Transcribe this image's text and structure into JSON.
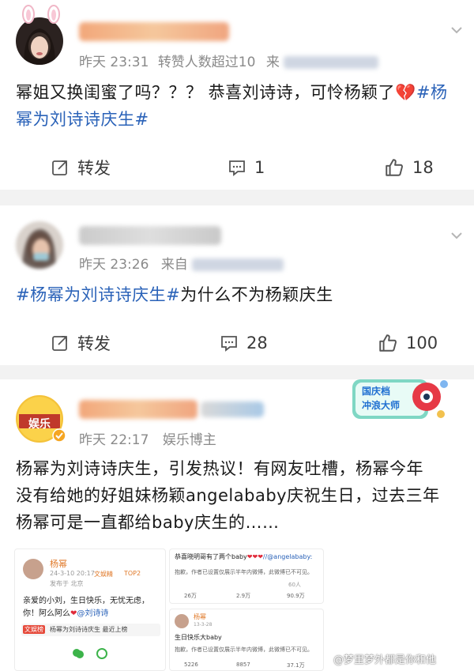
{
  "posts": [
    {
      "time": "昨天 23:31",
      "reposts_note": "转赞人数超过10",
      "source_prefix": "来",
      "content_text": "幂姐又换闺蜜了吗？？？  恭喜刘诗诗，可怜杨颖了",
      "hashtag": "#杨幂为刘诗诗庆生#",
      "repost_label": "转发",
      "comments": "1",
      "likes": "18"
    },
    {
      "time": "昨天 23:26",
      "source_prefix": "来自",
      "hashtag": "#杨幂为刘诗诗庆生#",
      "content_text": "为什么不为杨颖庆生",
      "repost_label": "转发",
      "comments": "28",
      "likes": "100"
    },
    {
      "time": "昨天 22:17",
      "source": "娱乐博主",
      "avatar_text": "娱乐",
      "badge_text_1": "国庆档",
      "badge_text_2": "冲浪大师",
      "content_lines": [
        "杨幂为刘诗诗庆生，引发热议！有网友吐槽，杨幂今年",
        "没有给她的好姐妹杨颖angelababy庆祝生日，过去三年",
        "杨幂可是一直都给baby庆生的……"
      ]
    }
  ],
  "screenshot": {
    "left": {
      "name": "杨幂",
      "date": "24-3-10 20:17",
      "tag1": "文娱精",
      "tag2": "TOP2",
      "loc": "发布于 北京",
      "text1": "亲爱的小刘，生日快乐，无忧无虑，",
      "text2": "你！阿么阿么",
      "mention": "@刘诗诗",
      "chip_tag": "文娱榜",
      "chip_text": "杨幂为刘诗诗庆生 最近上榜"
    },
    "right_top": {
      "text": "恭喜晓明哥有了两个baby",
      "mention": "//@angelababy:",
      "notice": "抱歉，作者已设置仅展示半年内微博，此微博已不可见。",
      "stat1": "26万",
      "stat2": "2.9万",
      "stat3": "90.9万",
      "small": "60人"
    },
    "right_bottom": {
      "name": "杨幂",
      "date": "13-3-28",
      "text": "生日快乐大baby",
      "notice": "抱歉，作者已设置仅展示半年内微博，此微博已不可见。",
      "stat1": "5226",
      "stat2": "8857",
      "stat3": "37.1万"
    },
    "watermark": "@梦里梦外都是你和他"
  },
  "colors": {
    "link": "#2a62b8",
    "meta": "#8a8a8a",
    "separator": "#f2f2f2",
    "heart": "#e02a3a"
  }
}
